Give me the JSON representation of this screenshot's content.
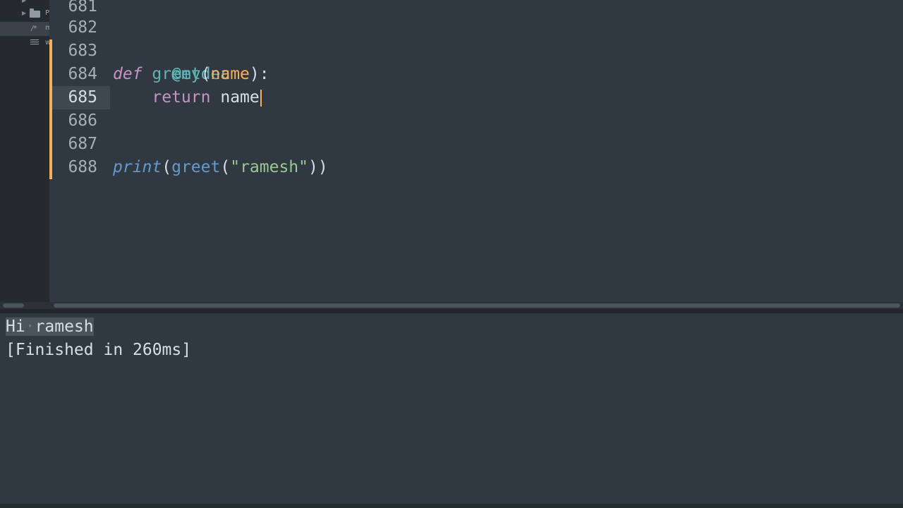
{
  "sidebar": {
    "items": [
      {
        "label": "P",
        "icon": "folder-icon"
      },
      {
        "label": "m",
        "icon": "comment-icon",
        "glyph": "/*"
      },
      {
        "label": "w",
        "icon": "lines-icon"
      }
    ]
  },
  "editor": {
    "lines": [
      {
        "number": "681"
      },
      {
        "number": "682"
      },
      {
        "number": "683",
        "decorator": "@mydec"
      },
      {
        "number": "684",
        "def": "def",
        "name": "greet",
        "lparen": "(",
        "param": "name",
        "rparen": ")",
        "colon": ":"
      },
      {
        "number": "685",
        "indent": "    ",
        "ret": "return",
        "space": " ",
        "value": "name"
      },
      {
        "number": "686"
      },
      {
        "number": "687"
      },
      {
        "number": "688",
        "print": "print",
        "open1": "(",
        "call": "greet",
        "open2": "(",
        "arg": "\"ramesh\"",
        "close": "))"
      }
    ],
    "current_line": "685"
  },
  "output": {
    "lines": [
      "Hi",
      "ramesh",
      "[Finished in 260ms]"
    ],
    "space_marker": "·"
  },
  "colors": {
    "background": "#303841",
    "decorator": "#5fb4b4",
    "keyword": "#c594c5",
    "function": "#5fb4b4",
    "param": "#f9ae58",
    "builtin": "#6699cc",
    "string": "#99c794",
    "cursor": "#f9ae58"
  }
}
